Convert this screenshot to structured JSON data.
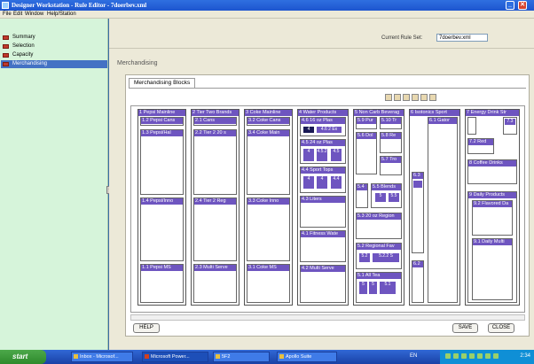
{
  "window": {
    "title": "Designer Workstation - Rule Editor - 7doerbev.xml"
  },
  "menu": [
    "File",
    "Edit",
    "Window",
    "Help/Station"
  ],
  "nav": {
    "items": [
      {
        "label": "Summary"
      },
      {
        "label": "Selection"
      },
      {
        "label": "Capacity"
      },
      {
        "label": "Merchandising"
      }
    ]
  },
  "main": {
    "rule_set_label": "Current Rule Set:",
    "rule_set_value": "7doerbev.xml",
    "section_title": "Merchandising",
    "tab_label": "Merchandising Blocks"
  },
  "columns": [
    {
      "header": "1 Pepsi Mainline",
      "blocks": [
        "1.2 Pepsi Cans",
        "1.3 Pepsi/Hal",
        "1.4 Pepsi/Inno",
        "1.1 Pepsi MS"
      ]
    },
    {
      "header": "2 Tier Two Brands",
      "blocks": [
        "2.1 Cans",
        "2.2 Tier 2 20 s",
        "2.4 Tier 2 Reg",
        "2.3 Multi Serve"
      ]
    },
    {
      "header": "3 Coke Mainline",
      "blocks": [
        "3.2 Coke Cans",
        "3.4 Coke Main",
        "3.3 Coke Inno",
        "3.1 Coke MS"
      ]
    },
    {
      "header": "4 Water Products",
      "blocks": [
        "4.6 16 oz Plas",
        "4.5 24 oz Plas",
        "4.4 Sport Tops",
        "4.3 Liters",
        "4.1 Fitness Wate",
        "4.2 Multi Serve"
      ]
    },
    {
      "header": "5 Non Carb Beverag",
      "blocks": [
        "5.9 Pur",
        "5.10 Tr",
        "5.6 Dol",
        "5.8 Re",
        "5.7 Tro",
        "5.4",
        "5.5 Blends",
        "5.3 20 oz Region",
        "5.2 Regional Fav",
        "5.1 All Tea"
      ]
    },
    {
      "header": "6 Isotonics Sport",
      "blocks": [
        "6.1 Gator",
        "6.3",
        "6.2"
      ]
    },
    {
      "header": "7 Energy Drink Str",
      "blocks": [
        "7.2 Red",
        "8 Coffee Drinks",
        "9 Daily Products",
        "9.2 Flavored Da",
        "9.1 Daily Multi"
      ]
    }
  ],
  "chips": {
    "water": [
      "4",
      "4.6 2 Ex"
    ],
    "plas24": [
      "4",
      "4.5.2",
      "4.5"
    ],
    "sport": [
      "4",
      "4",
      "4.4"
    ],
    "blends": [
      "5",
      "5.5"
    ],
    "regional": [
      "5.2",
      "5.2.2 S"
    ],
    "tea": [
      "5",
      "5",
      "5.1"
    ],
    "energy": [
      "7.3"
    ]
  },
  "buttons": {
    "help": "HELP",
    "save": "SAVE",
    "close": "CLOSE"
  },
  "taskbar": {
    "start": "start",
    "tasks": [
      "Inbox - Microsof...",
      "Microsoft Power...",
      "5F2",
      "Apollo Suite"
    ],
    "lang": "EN",
    "time": "2:34"
  }
}
